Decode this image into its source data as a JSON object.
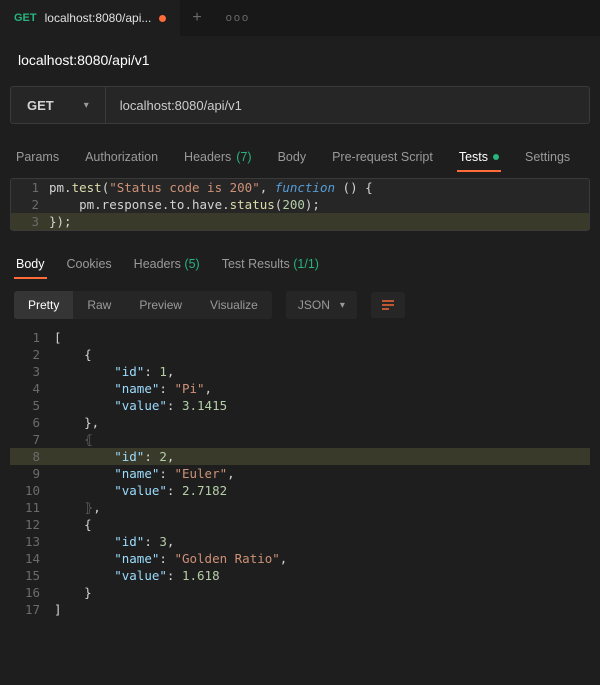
{
  "colors": {
    "accent": "#ff6c37",
    "green": "#26b47f"
  },
  "tabstrip": {
    "tabs": [
      {
        "method": "GET",
        "method_color": "#26b47f",
        "name": "localhost:8080/api...",
        "dirty": true
      }
    ],
    "add_label": "+",
    "more_label": "ooo"
  },
  "title": "localhost:8080/api/v1",
  "request": {
    "method": "GET",
    "url": "localhost:8080/api/v1"
  },
  "request_tabs": {
    "items": [
      {
        "label": "Params"
      },
      {
        "label": "Authorization"
      },
      {
        "label": "Headers",
        "count": "(7)"
      },
      {
        "label": "Body"
      },
      {
        "label": "Pre-request Script"
      },
      {
        "label": "Tests",
        "dot": true,
        "active": true
      },
      {
        "label": "Settings"
      }
    ]
  },
  "tests_script": {
    "lines": [
      {
        "n": 1,
        "tokens": [
          [
            "p",
            "pm."
          ],
          [
            "fn",
            "test"
          ],
          [
            "p",
            "("
          ],
          [
            "str",
            "\"Status code is 200\""
          ],
          [
            "p",
            ", "
          ],
          [
            "kw",
            "function"
          ],
          [
            "p",
            " () {"
          ]
        ]
      },
      {
        "n": 2,
        "tokens": [
          [
            "p",
            "    pm.response.to.have."
          ],
          [
            "fn",
            "status"
          ],
          [
            "p",
            "("
          ],
          [
            "num",
            "200"
          ],
          [
            "p",
            ");"
          ]
        ]
      },
      {
        "n": 3,
        "hl": true,
        "tokens": [
          [
            "p",
            "});"
          ]
        ]
      }
    ]
  },
  "response_tabs": {
    "items": [
      {
        "label": "Body",
        "active": true
      },
      {
        "label": "Cookies"
      },
      {
        "label": "Headers",
        "count": "(5)"
      },
      {
        "label": "Test Results",
        "count": "(1/1)"
      }
    ]
  },
  "response_tools": {
    "segments": [
      {
        "label": "Pretty",
        "active": true
      },
      {
        "label": "Raw"
      },
      {
        "label": "Preview"
      },
      {
        "label": "Visualize"
      }
    ],
    "format": {
      "label": "JSON"
    },
    "wrap_icon": "wrap-icon"
  },
  "response_body": {
    "lines": [
      {
        "n": 1,
        "tokens": [
          [
            "p",
            "["
          ]
        ]
      },
      {
        "n": 2,
        "tokens": [
          [
            "p",
            "    {"
          ]
        ]
      },
      {
        "n": 3,
        "tokens": [
          [
            "p",
            "        "
          ],
          [
            "key",
            "\"id\""
          ],
          [
            "p",
            ": "
          ],
          [
            "num",
            "1"
          ],
          [
            "p",
            ","
          ]
        ]
      },
      {
        "n": 4,
        "tokens": [
          [
            "p",
            "        "
          ],
          [
            "key",
            "\"name\""
          ],
          [
            "p",
            ": "
          ],
          [
            "str",
            "\"Pi\""
          ],
          [
            "p",
            ","
          ]
        ]
      },
      {
        "n": 5,
        "tokens": [
          [
            "p",
            "        "
          ],
          [
            "key",
            "\"value\""
          ],
          [
            "p",
            ": "
          ],
          [
            "num",
            "3.1415"
          ]
        ]
      },
      {
        "n": 6,
        "tokens": [
          [
            "p",
            "    },"
          ]
        ]
      },
      {
        "n": 7,
        "tokens": [
          [
            "p",
            "    "
          ],
          [
            "fold",
            "⦃"
          ]
        ]
      },
      {
        "n": 8,
        "hl": true,
        "tokens": [
          [
            "p",
            "        "
          ],
          [
            "key",
            "\"id\""
          ],
          [
            "p",
            ": "
          ],
          [
            "num",
            "2"
          ],
          [
            "p",
            ","
          ]
        ]
      },
      {
        "n": 9,
        "tokens": [
          [
            "p",
            "        "
          ],
          [
            "key",
            "\"name\""
          ],
          [
            "p",
            ": "
          ],
          [
            "str",
            "\"Euler\""
          ],
          [
            "p",
            ","
          ]
        ]
      },
      {
        "n": 10,
        "tokens": [
          [
            "p",
            "        "
          ],
          [
            "key",
            "\"value\""
          ],
          [
            "p",
            ": "
          ],
          [
            "num",
            "2.7182"
          ]
        ]
      },
      {
        "n": 11,
        "tokens": [
          [
            "p",
            "    "
          ],
          [
            "fold",
            "⦄"
          ],
          [
            "p",
            ","
          ]
        ]
      },
      {
        "n": 12,
        "tokens": [
          [
            "p",
            "    {"
          ]
        ]
      },
      {
        "n": 13,
        "tokens": [
          [
            "p",
            "        "
          ],
          [
            "key",
            "\"id\""
          ],
          [
            "p",
            ": "
          ],
          [
            "num",
            "3"
          ],
          [
            "p",
            ","
          ]
        ]
      },
      {
        "n": 14,
        "tokens": [
          [
            "p",
            "        "
          ],
          [
            "key",
            "\"name\""
          ],
          [
            "p",
            ": "
          ],
          [
            "str",
            "\"Golden Ratio\""
          ],
          [
            "p",
            ","
          ]
        ]
      },
      {
        "n": 15,
        "tokens": [
          [
            "p",
            "        "
          ],
          [
            "key",
            "\"value\""
          ],
          [
            "p",
            ": "
          ],
          [
            "num",
            "1.618"
          ]
        ]
      },
      {
        "n": 16,
        "tokens": [
          [
            "p",
            "    }"
          ]
        ]
      },
      {
        "n": 17,
        "tokens": [
          [
            "p",
            "]"
          ]
        ]
      }
    ]
  }
}
